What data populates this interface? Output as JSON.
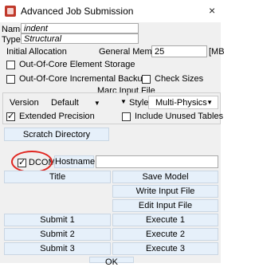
{
  "window": {
    "title": "Advanced Job Submission",
    "close_glyph": "×"
  },
  "job": {
    "name_label": "Name",
    "name_value": "indent",
    "type_label": "Type",
    "type_value": "Structural"
  },
  "allocation": {
    "initial_label": "Initial Allocation",
    "general_memory_label": "General Memory",
    "general_memory_value": "25",
    "general_memory_unit": "[MB"
  },
  "options": {
    "out_of_core_element_storage": {
      "label": "Out-Of-Core Element Storage",
      "checked": false
    },
    "out_of_core_incremental_backup": {
      "label": "Out-Of-Core Incremental Backup",
      "checked": false
    },
    "check_sizes": {
      "label": "Check Sizes",
      "checked": false
    }
  },
  "marc_input": {
    "heading": "Marc Input File",
    "version_label": "Version",
    "version_value": "Default",
    "style_label": "Style",
    "style_value": "Multi-Physics",
    "extended_precision": {
      "label": "Extended Precision",
      "checked": true
    },
    "include_unused_tables": {
      "label": "Include Unused Tables",
      "checked": false
    }
  },
  "buttons": {
    "scratch_directory": "Scratch Directory",
    "hostname": "Hostname",
    "title": "Title",
    "save_model": "Save Model",
    "write_input_file": "Write Input File",
    "edit_input_file": "Edit Input File",
    "submit_1": "Submit 1",
    "execute_1": "Execute 1",
    "submit_2": "Submit 2",
    "execute_2": "Execute 2",
    "submit_3": "Submit 3",
    "execute_3": "Execute 3",
    "ok": "OK"
  },
  "dcom": {
    "label": "DCOM",
    "checked": true
  },
  "colors": {
    "button_bg": "#e6f0fa",
    "panel_bg": "#f0f0f0",
    "highlight_circle": "#e0251f",
    "app_icon": "#c0392b"
  },
  "icons": {
    "app": "marc-app-icon",
    "close": "close-icon",
    "dropdown": "chevron-down-icon"
  }
}
